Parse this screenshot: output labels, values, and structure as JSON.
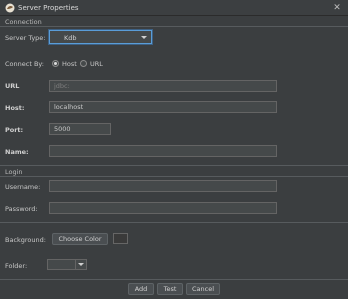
{
  "window": {
    "title": "Server Properties"
  },
  "sections": {
    "connection": "Connection",
    "login": "Login"
  },
  "server_type": {
    "label": "Server Type:",
    "value": "Kdb"
  },
  "connect_by": {
    "label": "Connect By:",
    "options": [
      "Host",
      "URL"
    ],
    "selected": "Host"
  },
  "fields": {
    "url": {
      "label": "URL",
      "value": "",
      "placeholder": "jdbc:"
    },
    "host": {
      "label": "Host:",
      "value": "localhost"
    },
    "port": {
      "label": "Port:",
      "value": "5000"
    },
    "name": {
      "label": "Name:",
      "value": ""
    },
    "username": {
      "label": "Username:",
      "value": ""
    },
    "password": {
      "label": "Password:",
      "value": ""
    }
  },
  "background": {
    "label": "Background:",
    "button": "Choose Color",
    "color": "#3a3a3a"
  },
  "folder": {
    "label": "Folder:",
    "value": ""
  },
  "footer": {
    "add": "Add",
    "test": "Test",
    "cancel": "Cancel"
  }
}
